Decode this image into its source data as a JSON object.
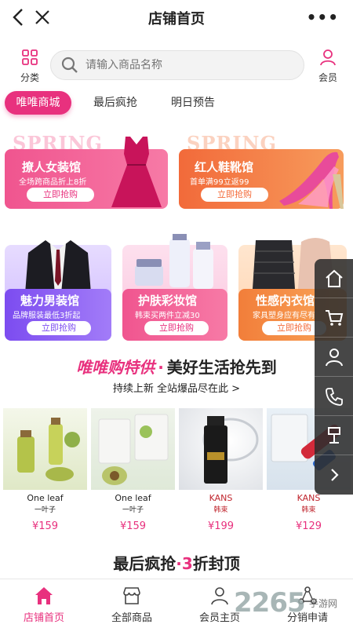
{
  "header": {
    "title": "店铺首页"
  },
  "search": {
    "placeholder": "请输入商品名称",
    "category_label": "分类",
    "member_label": "会员"
  },
  "tabs": [
    {
      "label": "唯唯商城"
    },
    {
      "label": "最后疯抢"
    },
    {
      "label": "明日预告"
    }
  ],
  "banners": [
    {
      "name": "撩人女装馆",
      "sub": "全场跨商品折上8折",
      "button": "立即抢购",
      "tag": "SPRING"
    },
    {
      "name": "红人鞋靴馆",
      "sub": "首单满99立返99",
      "button": "立即抢购",
      "tag": "SPRING"
    },
    {
      "name": "魅力男装馆",
      "sub": "品牌服装最低3折起",
      "button": "立即抢购"
    },
    {
      "name": "护肤彩妆馆",
      "sub": "韩束买两件立减30",
      "button": "立即抢购"
    },
    {
      "name": "性感内衣馆",
      "sub": "家具塑身应有尽有",
      "button": "立即抢购"
    }
  ],
  "special": {
    "title_pink": "唯唯购特供",
    "dot": "·",
    "title_rest": "美好生活抢先到",
    "subtitle": "持续上新 全站爆品尽在此 >"
  },
  "products": [
    {
      "brand": "One leaf",
      "brand_sub": "一叶子",
      "price": "¥159"
    },
    {
      "brand": "One leaf",
      "brand_sub": "一叶子",
      "price": "¥159"
    },
    {
      "brand": "KANS",
      "brand_sub": "韩束",
      "price": "¥199"
    },
    {
      "brand": "KANS",
      "brand_sub": "韩束",
      "price": "¥129"
    }
  ],
  "flash": {
    "title_a": "最后疯抢",
    "dot": "·",
    "title_pink": "3",
    "title_b": "折封顶"
  },
  "bottom_nav": [
    {
      "label": "店铺首页"
    },
    {
      "label": "全部商品"
    },
    {
      "label": "会员主页"
    },
    {
      "label": "分销申请"
    }
  ],
  "watermark": {
    "num": "2265",
    "text": "手游网"
  },
  "colors": {
    "accent": "#e8317e",
    "orange": "#f46b3a",
    "purple": "#8a5cf6"
  }
}
